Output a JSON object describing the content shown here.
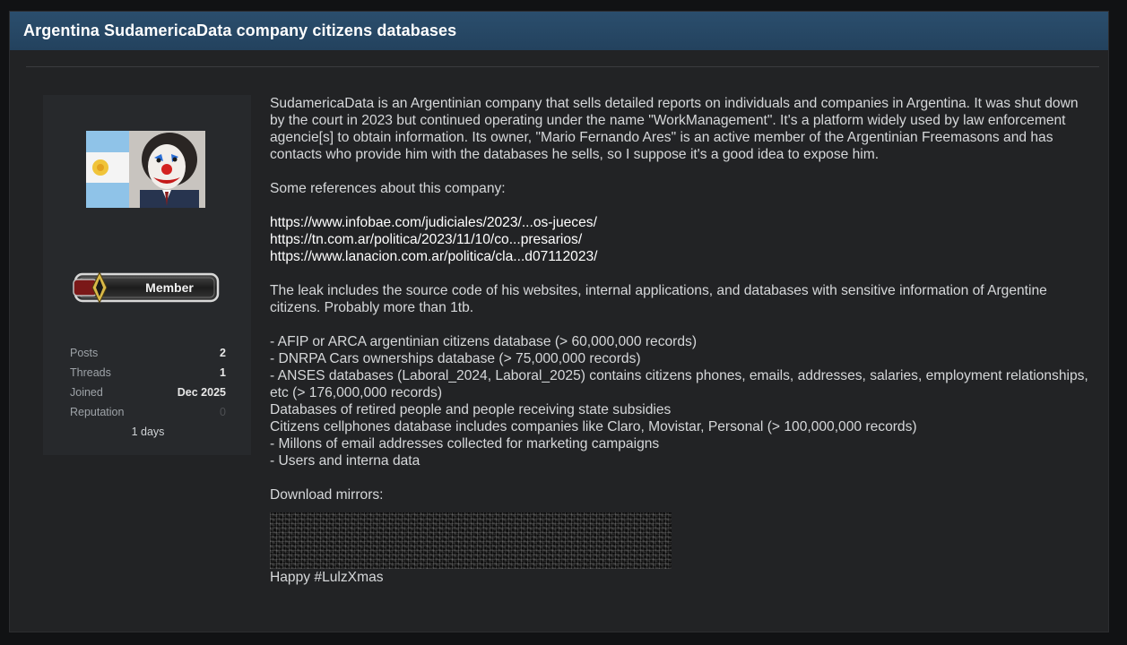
{
  "thread": {
    "title": "Argentina SudamericaData company citizens databases"
  },
  "user": {
    "avatar_icon": "clown-face-avatar",
    "rank": "Member",
    "stats": [
      {
        "label": "Posts",
        "value": "2"
      },
      {
        "label": "Threads",
        "value": "1"
      },
      {
        "label": "Joined",
        "value": "Dec 2025"
      },
      {
        "label": "Reputation",
        "value": "0"
      }
    ],
    "extra": "1 days"
  },
  "post": {
    "intro": "SudamericaData is an Argentinian company that sells detailed reports on individuals and companies in Argentina. It was shut down by the court in 2023 but continued operating under the name \"WorkManagement\". It's a platform widely used by law enforcement agencie[s] to obtain information. Its owner, \"Mario Fernando Ares\" is an active member of the Argentinian Freemasons and has contacts who provide him with the databases he sells, so I suppose it's a good idea to expose him.",
    "refs_heading": "Some references about this company:",
    "links": [
      "https://www.infobae.com/judiciales/2023/...os-jueces/",
      "https://tn.com.ar/politica/2023/11/10/co...presarios/",
      "https://www.lanacion.com.ar/politica/cla...d07112023/"
    ],
    "leak_intro": "The leak includes the source code of his websites, internal applications, and databases with sensitive information of Argentine citizens. Probably more than 1tb.",
    "items": [
      "- AFIP or ARCA argentinian citizens database (> 60,000,000 records)",
      "- DNRPA Cars ownerships database (> 75,000,000 records)",
      "- ANSES databases (Laboral_2024, Laboral_2025) contains citizens phones, emails, addresses, salaries, employment relationships, etc (> 176,000,000 records)",
      "Databases of retired people and people receiving state subsidies",
      "Citizens cellphones database includes companies like Claro, Movistar, Personal (> 100,000,000 records)",
      "- Millons of email addresses collected for marketing campaigns",
      "- Users and interna data"
    ],
    "download_heading": "Download mirrors:",
    "signoff": "Happy #LulzXmas"
  }
}
